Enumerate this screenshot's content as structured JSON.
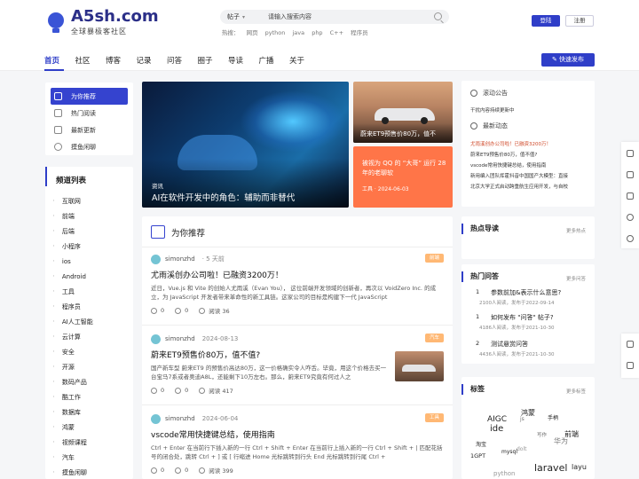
{
  "logo": {
    "title": "A5sh.com",
    "subtitle": "全球暴极客社区"
  },
  "search": {
    "scope": "帖子",
    "placeholder": "请输入搜索内容",
    "hot_label": "热搜：",
    "hot_terms": [
      "网页",
      "python",
      "java",
      "php",
      "C++",
      "程序员"
    ]
  },
  "auth": {
    "login": "登陆",
    "register": "注册"
  },
  "nav": {
    "items": [
      "首页",
      "社区",
      "博客",
      "记录",
      "问答",
      "圈子",
      "导读",
      "广播",
      "关于"
    ],
    "post_button": "快速发布"
  },
  "left_menu": {
    "items": [
      "为你推荐",
      "热门阅读",
      "最新更新",
      "摸鱼闲聊"
    ]
  },
  "channels": {
    "title": "频道列表",
    "items": [
      "互联网",
      "前端",
      "后端",
      "小程序",
      "ios",
      "Android",
      "工具",
      "程序员",
      "AI人工智能",
      "云计算",
      "安全",
      "开源",
      "数码产品",
      "酷工作",
      "数据库",
      "鸿蒙",
      "视频课程",
      "汽车",
      "摸鱼闲聊"
    ]
  },
  "hero": {
    "big": {
      "tag": "资讯",
      "title": "AI在软件开发中的角色：辅助而非替代"
    },
    "car": {
      "title": "蔚来ET9预售价80万，值不"
    },
    "orange": {
      "title": "被视为 QQ 的 “大哥” 运行 28 年的老聊软",
      "meta_tag": "工具",
      "meta_date": "2024-06-03"
    }
  },
  "recommend": {
    "title": "为你推荐",
    "articles": [
      {
        "author": "simonzhd",
        "date": "· 5 天前",
        "badge": "前端",
        "title": "尤雨溪创办公司啦！已融资3200万！",
        "desc": "近日，Vue.js 和 Vite 的创始人尤雨溪（Evan You）， 这位前端开发领域的创新者，再次以 VoidZero Inc. 的成立，为 JavaScript 开发者带来革命性的新工具链。这家公司的目标是构建下一代 JavaScript",
        "likes": "0",
        "comments": "0",
        "reads": "阅读 36"
      },
      {
        "author": "simonzhd",
        "date": "2024-08-13",
        "badge": "汽车",
        "title": "蔚来ET9预售价80万，值不值?",
        "desc": "国产新车型 蔚来ET9 的预售价高达80万，这一价格确实令人咋舌。毕竟，用这个价格去买一台宝马7系或者奥迪A8L，还能剩下10万左右。那么，蔚来ET9究竟有何过人之",
        "likes": "0",
        "comments": "0",
        "reads": "阅读 417"
      },
      {
        "author": "simonzhd",
        "date": "2024-06-04",
        "badge": "工具",
        "title": "vscode常用快捷键总结，使用指南",
        "desc": "Ctrl + Enter 在当前行下插入新的一行 Ctrl + Shift + Enter 在当前行上插入新的一行 Ctrl + Shift + | 匹配花括号的闭合处，跳转 Ctrl + ] 或 [ 行缩进 Home 光标跳转到行头 End 光标跳转到行尾 Ctrl +",
        "likes": "0",
        "comments": "0",
        "reads": "阅读 399"
      }
    ]
  },
  "notice": {
    "scroll_label": "滚动公告",
    "scroll_text": "干扰内容持续更新中",
    "latest_label": "最新动态",
    "latest": [
      "尤雨溪创办公司啦！已融资3200万！",
      "蔚来ET9预售价80万，值不值?",
      "vscode常用快捷键总结，使用指南",
      "新用编入团队挥霍抖音中国国产大模型：直接",
      "北京大学正式启动跨重航生应用开发，与自校"
    ]
  },
  "hot_guide": {
    "title": "热点导读",
    "more": "更多热点"
  },
  "hot_questions": {
    "title": "热门问答",
    "more": "更多问答",
    "items": [
      {
        "num": "1",
        "q": "参数前加&表示什么意思?",
        "d": "2100人阅读，发布于2022-09-14"
      },
      {
        "num": "1",
        "q": "如何发布 \"问答\" 帖子?",
        "d": "4186人阅读，发布于2021-10-30"
      },
      {
        "num": "2",
        "q": "测试悬赏问答",
        "d": "4436人阅读，发布于2021-10-30"
      }
    ]
  },
  "tags": {
    "title": "标签",
    "more": "更多标签",
    "words": [
      "AIGC",
      "ide",
      "鸿蒙",
      "js",
      "手柄",
      "写作",
      "前端",
      "华为",
      "淘宝",
      "mysql",
      "dolt",
      "1GPT",
      "laravel",
      "layu",
      "python"
    ]
  }
}
